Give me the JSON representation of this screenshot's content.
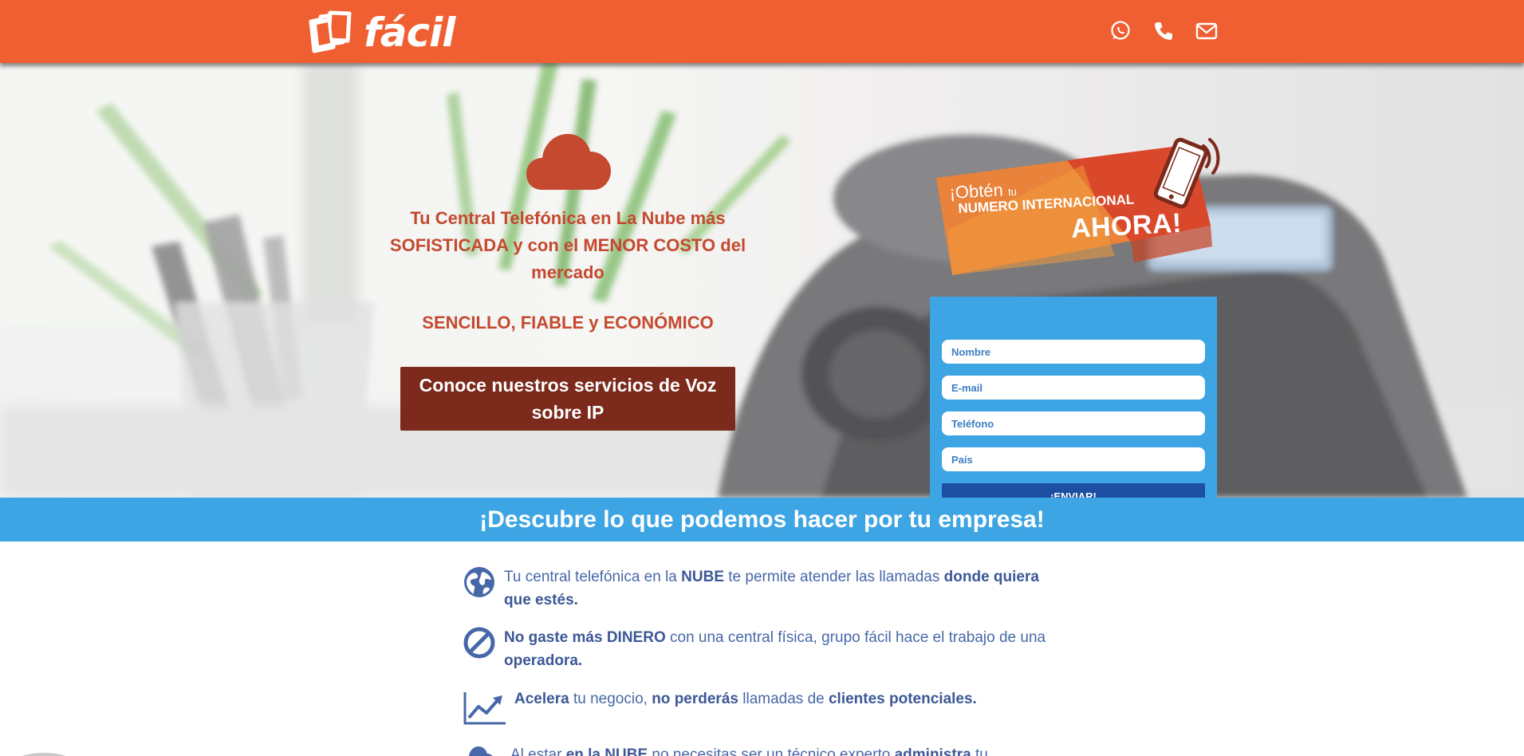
{
  "header": {
    "brand_name": "fácil",
    "contact_icons": [
      "whatsapp-icon",
      "phone-icon",
      "mail-icon"
    ],
    "background_color": "#ef5f31"
  },
  "hero": {
    "headline": "Tu Central Telefónica en La Nube más SOFISTICADA y con el MENOR COSTO del mercado",
    "tagline": "SENCILLO, FIABLE y ECONÓMICO",
    "cta_label": "Conoce nuestros servicios de Voz sobre IP",
    "icon": "cloud-icon",
    "text_color": "#c4492f",
    "cta_color": "#7b2a1c"
  },
  "promo": {
    "line1": "¡Obtén",
    "line1_small": "tu",
    "line2": "NUMERO INTERNACIONAL",
    "line3": "AHORA!",
    "icon": "smartphone-signal-icon"
  },
  "form": {
    "name_placeholder": "Nombre",
    "email_placeholder": "E-mail",
    "phone_placeholder": "Teléfono",
    "country_placeholder": "País",
    "submit_label": "¡ENVIAR!",
    "background_color": "#3ea5e4",
    "button_color": "#1c4fa1"
  },
  "section": {
    "title": "¡Descubre lo que podemos hacer por tu empresa!",
    "background_color": "#3ea5e4"
  },
  "features": [
    {
      "icon": "globe-icon",
      "parts": [
        "Tu central telefónica en la ",
        "NUBE",
        " te permite atender las llamadas ",
        "donde quiera que estés."
      ]
    },
    {
      "icon": "prohibited-icon",
      "parts": [
        "No gaste más DINERO",
        " con una central física, grupo fácil hace el trabajo de una ",
        "operadora."
      ]
    },
    {
      "icon": "trend-chart-icon",
      "parts": [
        "Acelera",
        " tu negocio, ",
        "no perderás",
        " llamadas de ",
        "clientes potenciales."
      ]
    },
    {
      "icon": "cloud-small-icon",
      "parts": [
        "Al estar ",
        "en la NUBE",
        " no necesitas ser un técnico experto ",
        "administra",
        " tu"
      ]
    }
  ]
}
